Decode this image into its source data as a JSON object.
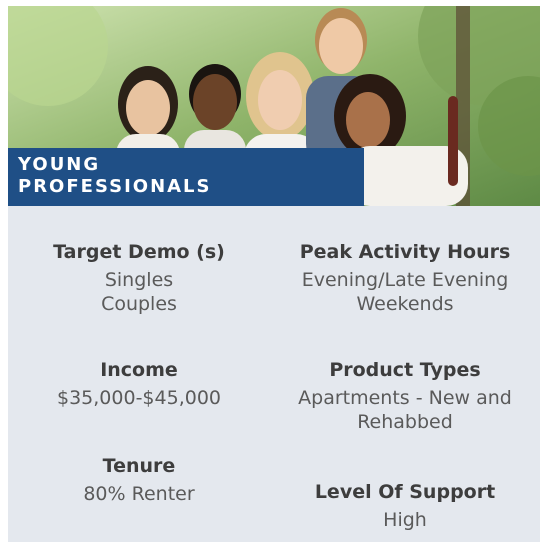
{
  "banner": {
    "line1": "YOUNG",
    "line2": "PROFESSIONALS"
  },
  "demographics": {
    "target_demo": {
      "label": "Target Demo (s)",
      "values": [
        "Singles",
        "Couples"
      ]
    },
    "peak_activity": {
      "label": "Peak Activity Hours",
      "values": [
        "Evening/Late Evening",
        "Weekends"
      ]
    },
    "income": {
      "label": "Income",
      "values": [
        "$35,000-$45,000"
      ]
    },
    "product_types": {
      "label": "Product Types",
      "values": [
        "Apartments - New and",
        "Rehabbed"
      ]
    },
    "tenure": {
      "label": "Tenure",
      "values": [
        "80% Renter"
      ]
    },
    "level_of_support": {
      "label": "Level Of Support",
      "values": [
        "High"
      ]
    }
  },
  "colors": {
    "banner_bg": "#1f4f86",
    "panel_bg": "#e4e8ee"
  }
}
